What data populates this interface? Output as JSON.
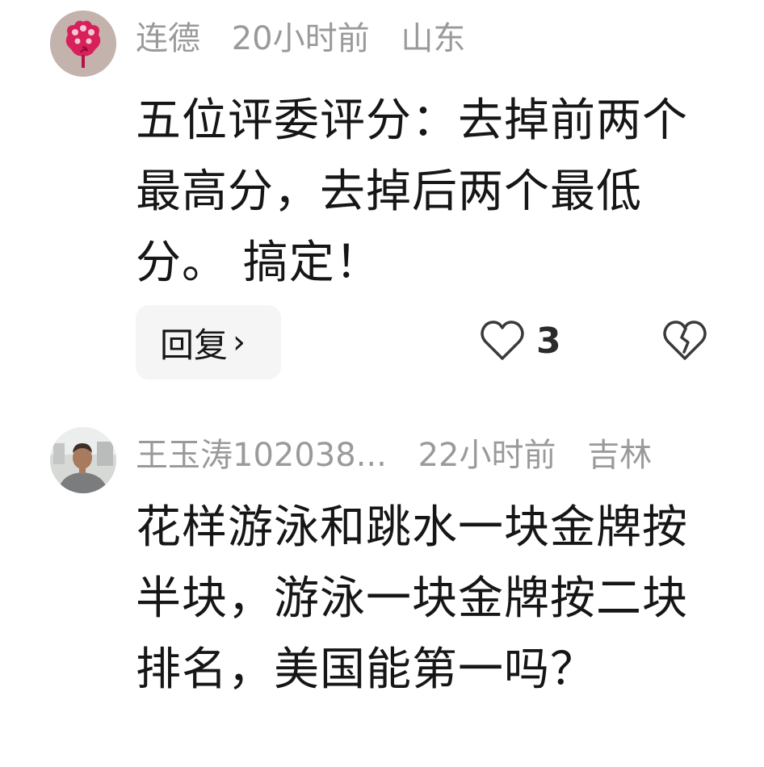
{
  "comments": [
    {
      "username": "连德",
      "time": "20小时前",
      "region": "山东",
      "text": "五位评委评分：去掉前两个最高分，去掉后两个最低分。 搞定！",
      "reply_label": "回复",
      "reply_chevron": "›",
      "likes": "3",
      "avatar": "red-flower-avatar",
      "icons": {
        "like": "heart-outline-icon",
        "dislike": "broken-heart-icon"
      }
    },
    {
      "username": "王玉涛102038...",
      "time": "22小时前",
      "region": "吉林",
      "text": "花样游泳和跳水一块金牌按半块，游泳一块金牌按二块排名，美国能第一吗？",
      "avatar": "man-photo-avatar"
    }
  ],
  "colors": {
    "meta_text": "#9a9a9a",
    "body_text": "#161616",
    "reply_bg": "#f5f5f5",
    "avatar1_bg": "#c9b7b2",
    "avatar1_flower": "#d8205a"
  }
}
